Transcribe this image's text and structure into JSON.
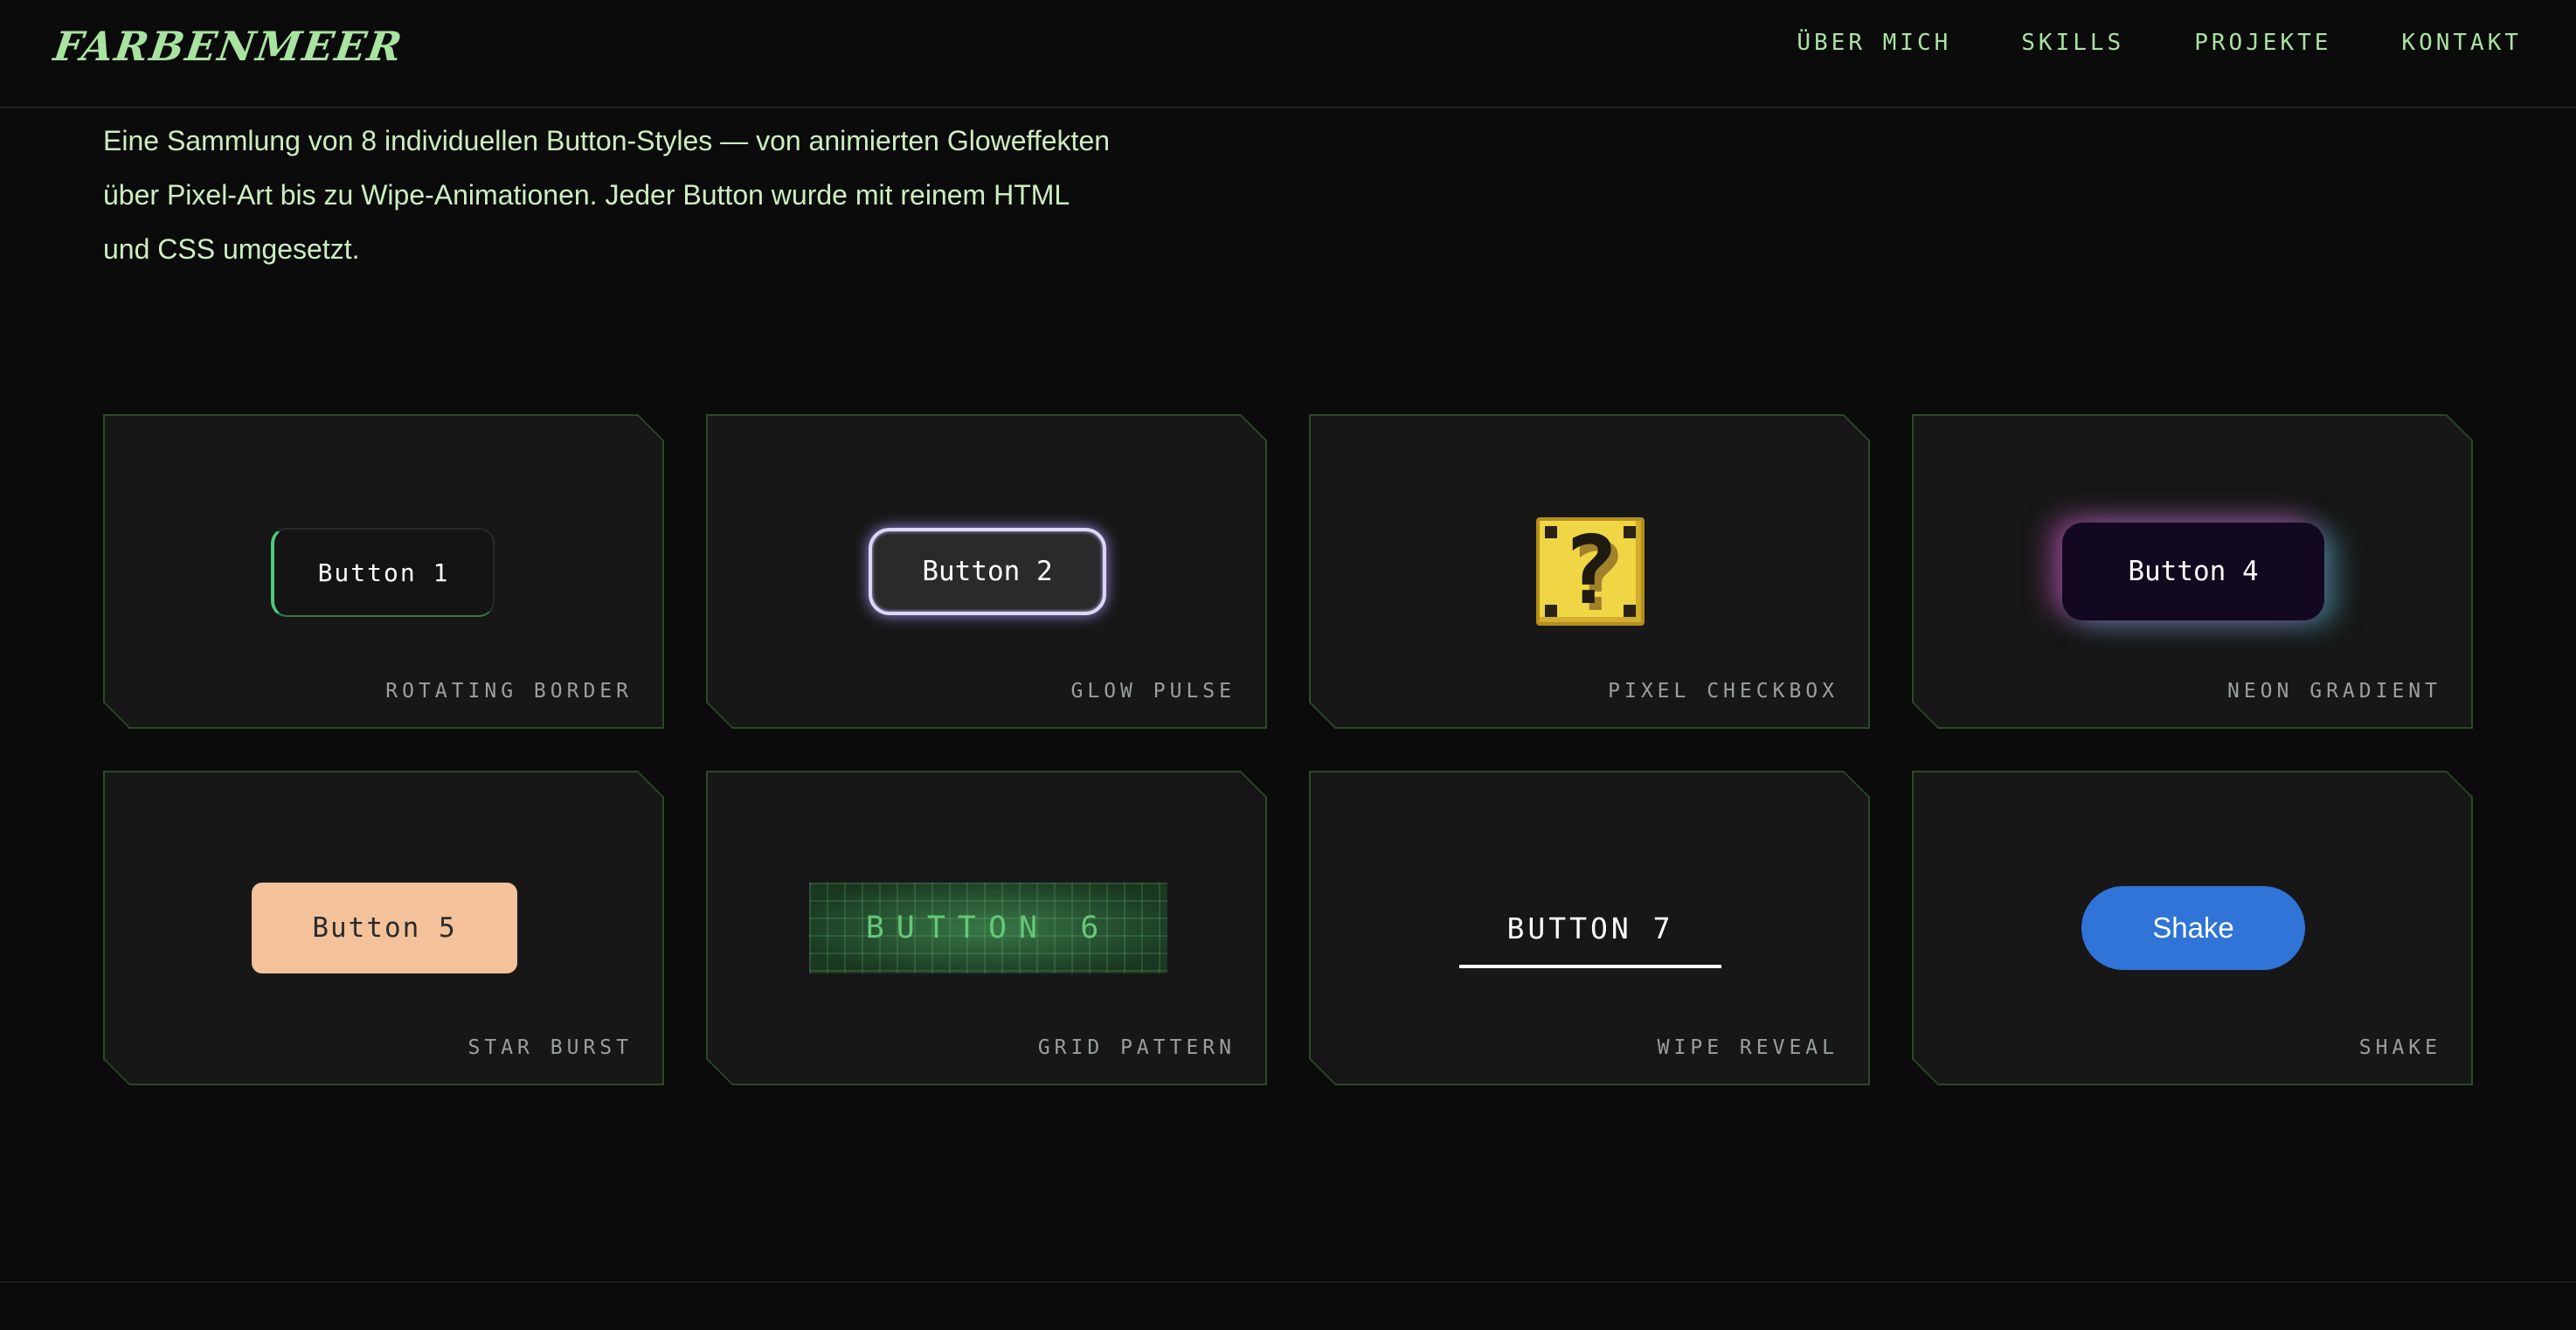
{
  "header": {
    "logo": "Farbenmeer",
    "nav": [
      "ÜBER MICH",
      "SKILLS",
      "PROJEKTE",
      "KONTAKT"
    ]
  },
  "intro": {
    "text_lines": [
      "Eine Sammlung von 8 individuellen Button-Styles — von animierten Gloweffekten",
      "über Pixel-Art bis zu Wipe-Animationen. Jeder Button wurde mit reinem HTML",
      "und CSS umgesetzt."
    ]
  },
  "cards": [
    {
      "button": "Button 1",
      "label": "ROTATING BORDER"
    },
    {
      "button": "Button 2",
      "label": "GLOW PULSE"
    },
    {
      "button": "?",
      "label": "PIXEL CHECKBOX"
    },
    {
      "button": "Button 4",
      "label": "NEON GRADIENT"
    },
    {
      "button": "Button 5",
      "label": "STAR BURST"
    },
    {
      "button": "BUTTON 6",
      "label": "GRID PATTERN"
    },
    {
      "button": "BUTTON 7",
      "label": "WIPE REVEAL"
    },
    {
      "button": "Shake",
      "label": "SHAKE"
    }
  ],
  "colors": {
    "background": "#0b0b0b",
    "card_bg": "#171717",
    "card_border": "#2a4a27",
    "accent_green": "#a9e3a0",
    "button5_bg": "#f3c29a",
    "button8_bg": "#2f74d6",
    "pixel_yellow": "#f0d545"
  }
}
